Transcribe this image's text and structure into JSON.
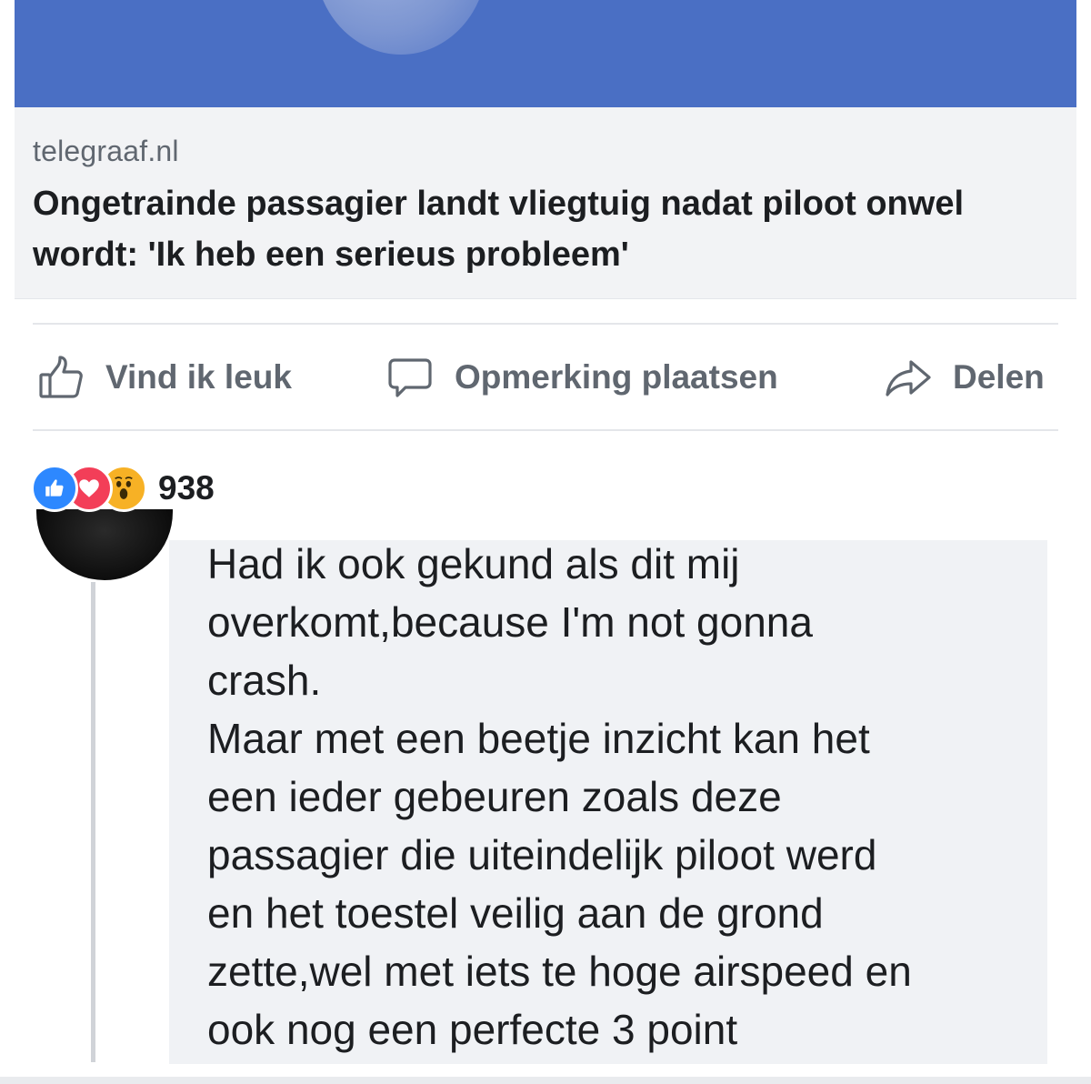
{
  "link_preview": {
    "domain": "telegraaf.nl",
    "title": "Ongetrainde passagier landt vliegtuig nadat piloot onwel wordt: 'Ik heb een serieus probleem'"
  },
  "actions": {
    "like_label": "Vind ik leuk",
    "comment_label": "Opmerking plaatsen",
    "share_label": "Delen",
    "like_icon": "thumbs-up-icon",
    "comment_icon": "speech-bubble-icon",
    "share_icon": "share-arrow-icon"
  },
  "reactions": {
    "types": [
      "like",
      "love",
      "wow"
    ],
    "count": "938"
  },
  "comment": {
    "text": "Had ik ook gekund als dit mij\noverkomt,because I'm not gonna\ncrash.\nMaar met een beetje inzicht kan het\neen ieder gebeuren zoals deze\npassagier die uiteindelijk piloot werd\nen het toestel veilig aan de grond\nzette,wel met iets te hoge airspeed en\nook nog een perfecte 3 point"
  },
  "colors": {
    "banner": "#4a6fc4",
    "preview_bg": "#f2f3f5",
    "action_text": "#606770",
    "like_blue": "#2d88ff",
    "love_red": "#f33e58",
    "wow_yellow": "#f7b125",
    "comment_bg": "#f0f2f5"
  }
}
